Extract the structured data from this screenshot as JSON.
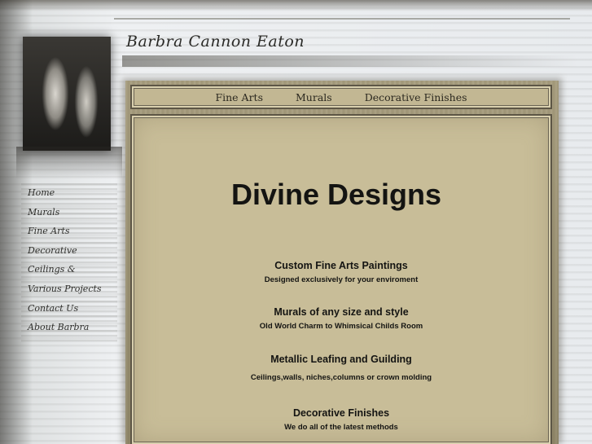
{
  "site_title": "Barbra Cannon Eaton",
  "top_menu": [
    "Fine Arts",
    "Murals",
    "Decorative Finishes"
  ],
  "left_nav": [
    "Home",
    "Murals",
    "Fine Arts",
    "Decorative",
    "Ceilings &",
    "Various Projects",
    "Contact Us",
    "About Barbra"
  ],
  "headline": "Divine Designs",
  "services": [
    {
      "title": "Custom Fine Arts Paintings",
      "desc": "Designed exclusively for your enviroment"
    },
    {
      "title": "Murals of any size and style",
      "desc": "Old World Charm to Whimsical Childs Room"
    },
    {
      "title": "Metallic Leafing and Guilding",
      "desc": "Ceilings,walls, niches,columns or crown molding"
    },
    {
      "title": "Decorative Finishes",
      "desc": "We do all of the latest methods"
    }
  ]
}
